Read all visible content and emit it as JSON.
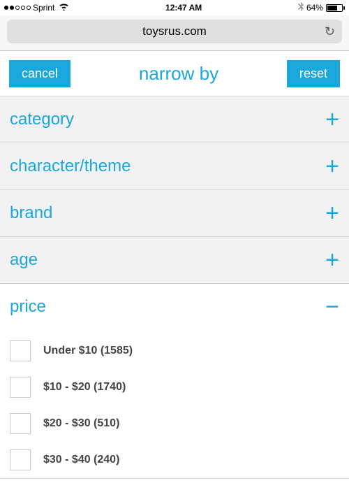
{
  "status": {
    "carrier": "Sprint",
    "time": "12:47 AM",
    "battery_pct": "64%"
  },
  "url": {
    "domain": "toysrus.com"
  },
  "actions": {
    "cancel": "cancel",
    "title": "narrow by",
    "reset": "reset"
  },
  "facets": [
    {
      "label": "category",
      "expanded": false
    },
    {
      "label": "character/theme",
      "expanded": false
    },
    {
      "label": "brand",
      "expanded": false
    },
    {
      "label": "age",
      "expanded": false
    },
    {
      "label": "price",
      "expanded": true,
      "options": [
        {
          "label": "Under $10 (1585)"
        },
        {
          "label": "$10 - $20 (1740)"
        },
        {
          "label": "$20 - $30 (510)"
        },
        {
          "label": "$30 - $40 (240)"
        }
      ]
    }
  ],
  "icons": {
    "plus": "+",
    "minus": "−",
    "reload": "↻"
  }
}
